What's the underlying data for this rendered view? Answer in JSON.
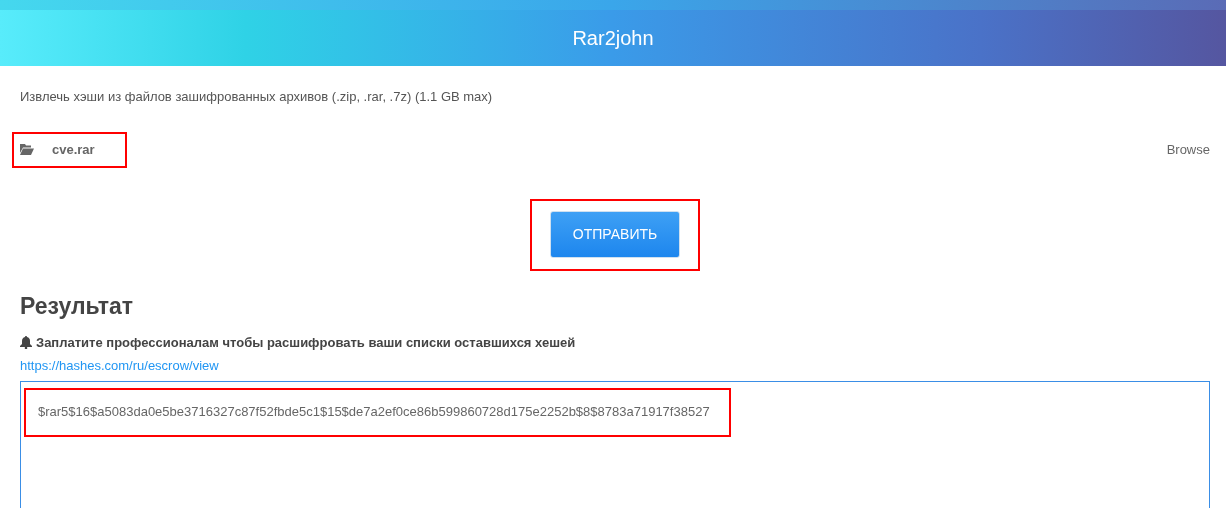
{
  "header": {
    "title": "Rar2john"
  },
  "description": "Извлечь хэши из файлов зашифрованных архивов (.zip, .rar, .7z) (1.1 GB max)",
  "file": {
    "name": "cve.rar",
    "browse": "Browse",
    "highlighted": true
  },
  "submit": {
    "label": "ОТПРАВИТЬ",
    "highlighted": true
  },
  "result": {
    "heading": "Результат",
    "notice": "Заплатите профессионалам чтобы расшифровать ваши списки оставшихся хешей",
    "link": "https://hashes.com/ru/escrow/view",
    "hash": "$rar5$16$a5083da0e5be3716327c87f52fbde5c1$15$de7a2ef0ce86b599860728d175e2252b$8$8783a71917f38527",
    "highlighted": true
  }
}
